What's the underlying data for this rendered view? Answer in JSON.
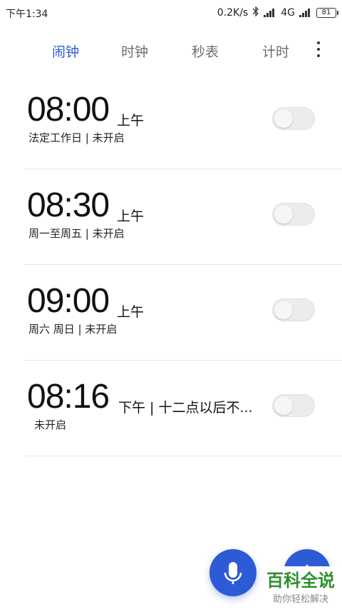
{
  "status_bar": {
    "time": "下午1:34",
    "network_speed": "0.2K/s",
    "network_type": "4G",
    "battery": "81"
  },
  "tabs": [
    {
      "label": "闹钟",
      "active": true
    },
    {
      "label": "时钟",
      "active": false
    },
    {
      "label": "秒表",
      "active": false
    },
    {
      "label": "计时",
      "active": false
    }
  ],
  "alarms": [
    {
      "time": "08:00",
      "ampm": "上午",
      "subtitle": "法定工作日 | 未开启",
      "enabled": false
    },
    {
      "time": "08:30",
      "ampm": "上午",
      "subtitle": "周一至周五 | 未开启",
      "enabled": false
    },
    {
      "time": "09:00",
      "ampm": "上午",
      "subtitle": "周六 周日 | 未开启",
      "enabled": false
    },
    {
      "time": "08:16",
      "ampm": "下午 | 十二点以后不...",
      "subtitle": "未开启",
      "enabled": false
    }
  ],
  "watermark": {
    "main": "百科全说",
    "sub": "助你轻松解决"
  },
  "colors": {
    "accent": "#2d5bd6",
    "toggle_off": "#ececec",
    "divider": "#e6e6e6",
    "watermark": "#2d8e2d"
  }
}
